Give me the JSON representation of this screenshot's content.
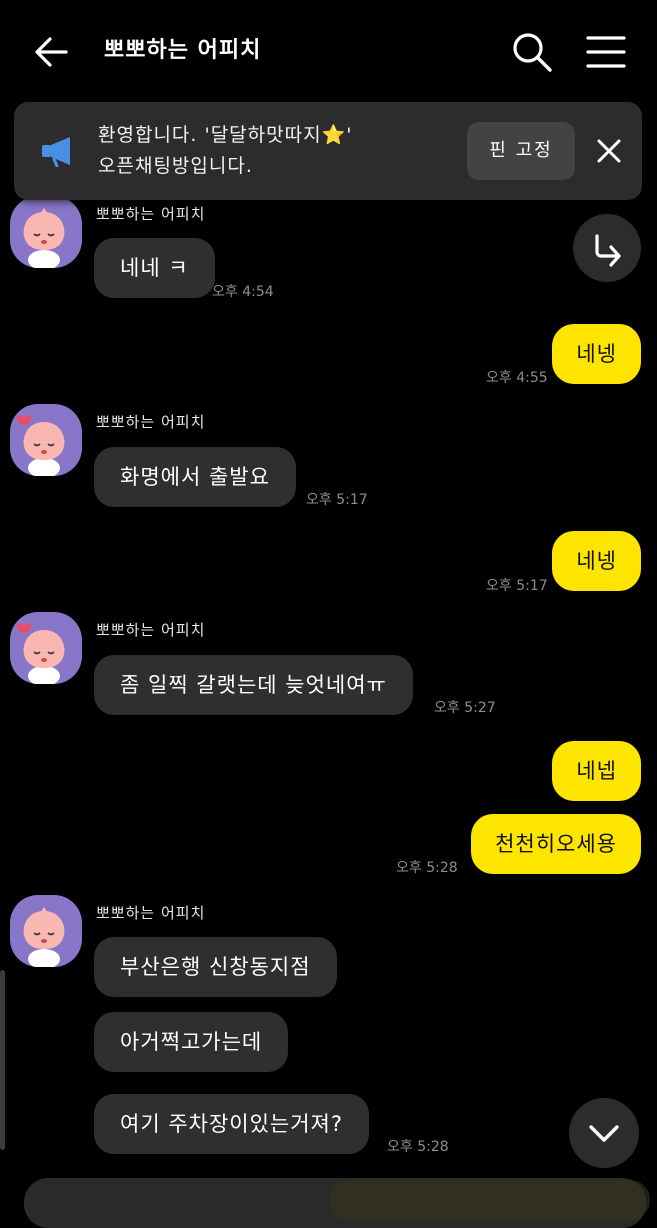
{
  "header": {
    "title": "뽀뽀하는 어피치",
    "icons": {
      "back": "back-arrow-icon",
      "search": "search-icon",
      "menu": "menu-icon"
    }
  },
  "notice": {
    "line1_prefix": "환영합니다. '달달하맛따지",
    "line1_star": "⭐",
    "line1_suffix": "'",
    "line2": "오픈채팅방입니다.",
    "pin_label": "핀 고정",
    "icons": {
      "megaphone": "megaphone-icon",
      "close": "close-icon"
    }
  },
  "messages": [
    {
      "sender": "뽀뽀하는 어피치",
      "text": "네네 ㅋ",
      "time": "오후 4:54"
    },
    {
      "mine": true,
      "text": "네넹",
      "time": "오후 4:55"
    },
    {
      "sender": "뽀뽀하는 어피치",
      "text": "화명에서 출발요",
      "time": "오후 5:17"
    },
    {
      "mine": true,
      "text": "네넹",
      "time": "오후 5:17"
    },
    {
      "sender": "뽀뽀하는 어피치",
      "text": "좀 일찍 갈랫는데 늦엇네여ㅠ",
      "time": "오후 5:27"
    },
    {
      "mine": true,
      "text": "네넵"
    },
    {
      "mine": true,
      "text": "천천히오세용",
      "time": "오후 5:28"
    },
    {
      "sender": "뽀뽀하는 어피치",
      "text": "부산은행 신창동지점"
    },
    {
      "text": "아거쩍고가는데"
    },
    {
      "text": "여기 주차장이있는거져?",
      "time": "오후 5:28"
    }
  ],
  "colors": {
    "my_bubble": "#fee500",
    "their_bubble": "#2f2f31",
    "background": "#000000",
    "notice_bg": "#2c2c2e"
  },
  "floating": {
    "share": "share-arrow-icon",
    "scroll_down": "chevron-down-icon"
  }
}
